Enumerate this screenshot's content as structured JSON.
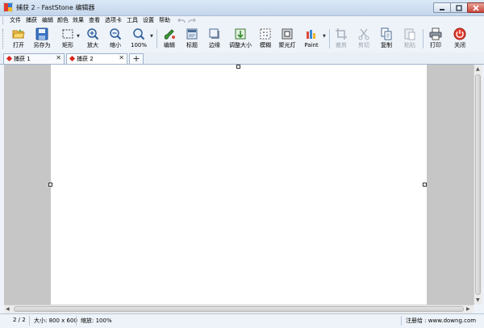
{
  "window": {
    "title": "捕获 2 - FastStone 编辑器"
  },
  "menu": [
    "文件",
    "捕获",
    "编辑",
    "颜色",
    "效果",
    "查看",
    "选项卡",
    "工具",
    "设置",
    "帮助"
  ],
  "toolbar": {
    "open": "打开",
    "save_as": "另存为",
    "rect": "矩形",
    "zoom_in": "放大",
    "zoom_out": "缩小",
    "zoom_level": "100%",
    "edit": "编辑",
    "caption": "标题",
    "edge": "边缘",
    "resize": "调整大小",
    "blur": "模糊",
    "spotlight": "聚光灯",
    "paint": "Paint",
    "crop": "裁剪",
    "cut": "剪切",
    "copy": "复制",
    "paste": "粘贴",
    "print": "打印",
    "close": "关闭"
  },
  "tabs": [
    {
      "label": "捕获 1",
      "active": false
    },
    {
      "label": "捕获 2",
      "active": true
    }
  ],
  "tab_add": "+",
  "status": {
    "page": "2 / 2",
    "size": "大小: 800 x 600",
    "zoom": "缩放: 100%",
    "registered": "注册给 : www.downg.com"
  },
  "colors": {
    "tab_marker": "#d7261e",
    "canvas": "#ffffff",
    "workspace": "#c6c6c6"
  }
}
